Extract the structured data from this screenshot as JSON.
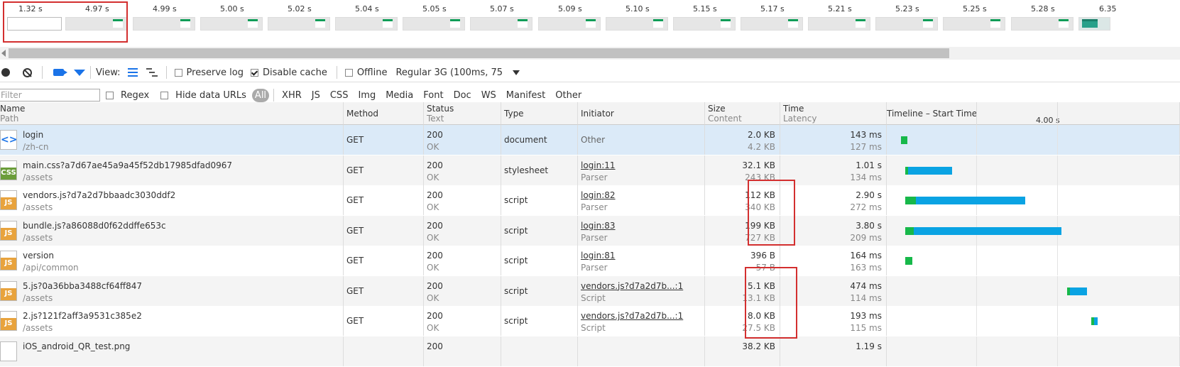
{
  "filmstrip": {
    "times": [
      "1.32 s",
      "4.97 s",
      "4.99 s",
      "5.00 s",
      "5.02 s",
      "5.04 s",
      "5.05 s",
      "5.07 s",
      "5.09 s",
      "5.10 s",
      "5.15 s",
      "5.17 s",
      "5.21 s",
      "5.23 s",
      "5.25 s",
      "5.28 s",
      "6.35"
    ]
  },
  "toolbar": {
    "view_label": "View:",
    "preserve_log": "Preserve log",
    "disable_cache": "Disable cache",
    "offline": "Offline",
    "throttle": "Regular 3G (100ms, 75",
    "preserve_log_checked": false,
    "disable_cache_checked": true,
    "offline_checked": false
  },
  "filterbar": {
    "placeholder": "Filter",
    "regex": "Regex",
    "hide_data_urls": "Hide data URLs",
    "types": [
      "All",
      "XHR",
      "JS",
      "CSS",
      "Img",
      "Media",
      "Font",
      "Doc",
      "WS",
      "Manifest",
      "Other"
    ]
  },
  "columns": {
    "name": "Name",
    "path": "Path",
    "method": "Method",
    "status": "Status",
    "text": "Text",
    "type": "Type",
    "initiator": "Initiator",
    "size": "Size",
    "content": "Content",
    "time": "Time",
    "latency": "Latency",
    "timeline": "Timeline – Start Time",
    "timeline_tick": "4.00 s"
  },
  "rows": [
    {
      "name": "login",
      "path": "/zh-cn",
      "method": "GET",
      "status": "200",
      "text": "OK",
      "type": "document",
      "initiator": "Other",
      "initiator2": "",
      "size": "2.0 KB",
      "content": "4.2 KB",
      "time": "143 ms",
      "latency": "127 ms",
      "icon": "doc",
      "wait_start": 0.6,
      "wait_end": 1.6,
      "recv_end": 1.6
    },
    {
      "name": "main.css?a7d67ae45a9a45f52db17985dfad0967",
      "path": "/assets",
      "method": "GET",
      "status": "200",
      "text": "OK",
      "type": "stylesheet",
      "initiator": "login:11",
      "initiator2": "Parser",
      "size": "32.1 KB",
      "content": "243 KB",
      "time": "1.01 s",
      "latency": "134 ms",
      "icon": "css",
      "wait_start": 1.3,
      "wait_end": 1.7,
      "recv_end": 8.3
    },
    {
      "name": "vendors.js?d7a2d7bbaadc3030ddf2",
      "path": "/assets",
      "method": "GET",
      "status": "200",
      "text": "OK",
      "type": "script",
      "initiator": "login:82",
      "initiator2": "Parser",
      "size": "112 KB",
      "content": "340 KB",
      "time": "2.90 s",
      "latency": "272 ms",
      "icon": "js",
      "wait_start": 1.3,
      "wait_end": 2.9,
      "recv_end": 19.2
    },
    {
      "name": "bundle.js?a86088d0f62ddffe653c",
      "path": "/assets",
      "method": "GET",
      "status": "200",
      "text": "OK",
      "type": "script",
      "initiator": "login:83",
      "initiator2": "Parser",
      "size": "199 KB",
      "content": "727 KB",
      "time": "3.80 s",
      "latency": "209 ms",
      "icon": "js",
      "wait_start": 1.3,
      "wait_end": 2.5,
      "recv_end": 24.5
    },
    {
      "name": "version",
      "path": "/api/common",
      "method": "GET",
      "status": "200",
      "text": "OK",
      "type": "script",
      "initiator": "login:81",
      "initiator2": "Parser",
      "size": "396 B",
      "content": "57 B",
      "time": "164 ms",
      "latency": "163 ms",
      "icon": "js",
      "wait_start": 1.3,
      "wait_end": 2.3,
      "recv_end": 2.3
    },
    {
      "name": "5.js?0a36bba3488cf64ff847",
      "path": "/assets",
      "method": "GET",
      "status": "200",
      "text": "OK",
      "type": "script",
      "initiator": "vendors.js?d7a2d7b...:1",
      "initiator2": "Script",
      "size": "5.1 KB",
      "content": "13.1 KB",
      "time": "474 ms",
      "latency": "114 ms",
      "icon": "js",
      "wait_start": 25.4,
      "wait_end": 25.8,
      "recv_end": 28.4
    },
    {
      "name": "2.js?121f2aff3a9531c385e2",
      "path": "/assets",
      "method": "GET",
      "status": "200",
      "text": "OK",
      "type": "script",
      "initiator": "vendors.js?d7a2d7b...:1",
      "initiator2": "Script",
      "size": "8.0 KB",
      "content": "27.5 KB",
      "time": "193 ms",
      "latency": "115 ms",
      "icon": "js",
      "wait_start": 29.0,
      "wait_end": 29.4,
      "recv_end": 30.0
    },
    {
      "name": "iOS_android_QR_test.png",
      "path": "",
      "method": "",
      "status": "200",
      "text": "",
      "type": "",
      "initiator": "",
      "initiator2": "",
      "size": "38.2 KB",
      "content": "",
      "time": "1.19 s",
      "latency": "",
      "icon": "img",
      "wait_start": 0,
      "wait_end": 0,
      "recv_end": 0
    }
  ]
}
